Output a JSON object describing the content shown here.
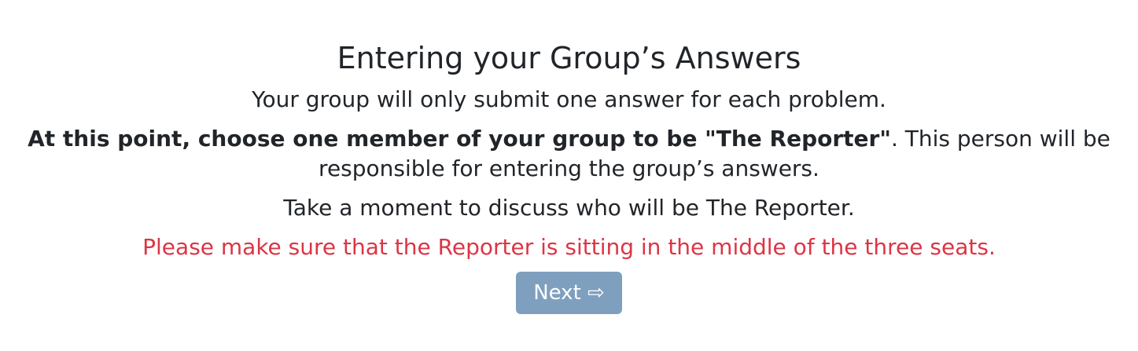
{
  "page": {
    "title": "Entering your Group’s Answers",
    "line1": "Your group will only submit one answer for each problem.",
    "line2_bold": "At this point, choose one member of your group to be \"The Reporter\"",
    "line2_rest": ". This person will be responsible for entering the group’s answers.",
    "line3": "Take a moment to discuss who will be The Reporter.",
    "warning": "Please make sure that the Reporter is sitting in the middle of the three seats."
  },
  "button": {
    "label": "Next ⇨",
    "color": "#7f9fbe"
  },
  "colors": {
    "warning": "#dc3545",
    "text": "#212529"
  }
}
